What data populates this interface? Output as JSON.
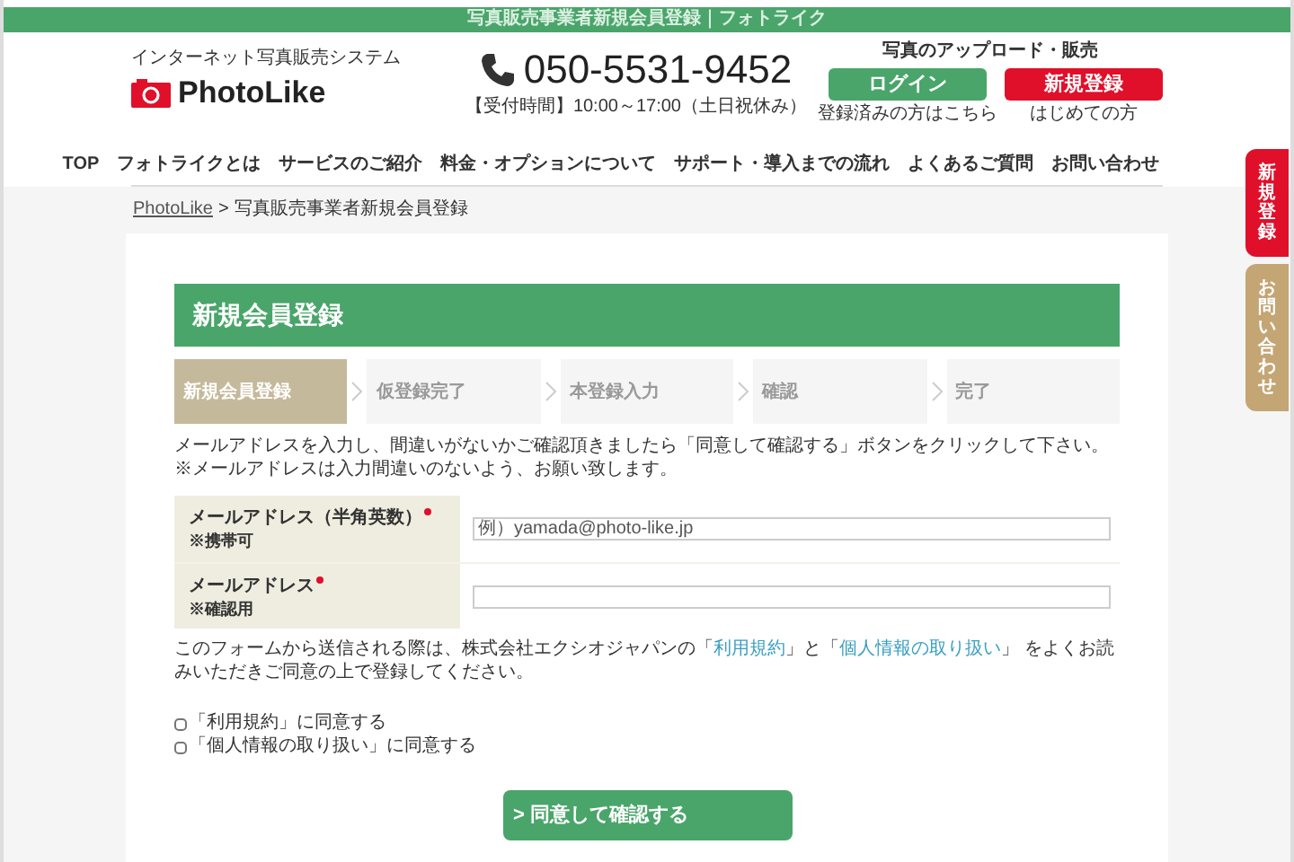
{
  "top_banner": "写真販売事業者新規会員登録｜フォトライク",
  "header": {
    "tagline": "インターネット写真販売システム",
    "logo": "PhotoLike",
    "phone": "050-5531-9452",
    "hours": "【受付時間】10:00～17:00（土日祝休み）",
    "account_title": "写真のアップロード・販売",
    "buttons": [
      {
        "label": "ログイン",
        "note": "登録済みの方はこちら",
        "kind": "login"
      },
      {
        "label": "新規登録",
        "note": "はじめての方",
        "kind": "signup"
      }
    ]
  },
  "nav": [
    "TOP",
    "フォトライクとは",
    "サービスのご紹介",
    "料金・オプションについて",
    "サポート・導入までの流れ",
    "よくあるご質問",
    "お問い合わせ"
  ],
  "side_tabs": [
    {
      "label": "新規登録",
      "kind": "signup"
    },
    {
      "label": "お問い合わせ",
      "kind": "contact"
    }
  ],
  "breadcrumb": {
    "link": "PhotoLike",
    "separator": ">",
    "current": "写真販売事業者新規会員登録"
  },
  "heading": "新規会員登録",
  "steps": [
    {
      "label": "新規会員登録",
      "selected": true
    },
    {
      "label": "仮登録完了",
      "selected": false
    },
    {
      "label": "本登録入力",
      "selected": false
    },
    {
      "label": "確認",
      "selected": false
    },
    {
      "label": "完了",
      "selected": false
    }
  ],
  "intro": [
    "メールアドレスを入力し、間違いがないかご確認頂きましたら「同意して確認する」ボタンをクリックして下さい。",
    "※メールアドレスは入力間違いのないよう、お願い致します。"
  ],
  "fields": [
    {
      "label": "メールアドレス（半角英数）",
      "required": true,
      "note": "※携帯可",
      "placeholder": "例）yamada@photo-like.jp"
    },
    {
      "label": "メールアドレス",
      "required": true,
      "note": "※確認用"
    }
  ],
  "notice": {
    "before": "このフォームから送信される際は、株式会社エクシオジャパンの「",
    "link_1": "利用規約",
    "middle": "」と「",
    "link_2": "個人情報の取り扱い",
    "after": "」 をよくお読みいただきご同意の上で登録してください。"
  },
  "agreements": [
    {
      "label": "「利用規約」に同意する",
      "checked": false
    },
    {
      "label": "「個人情報の取り扱い」に同意する",
      "checked": false
    }
  ],
  "submit": "> 同意して確認する"
}
